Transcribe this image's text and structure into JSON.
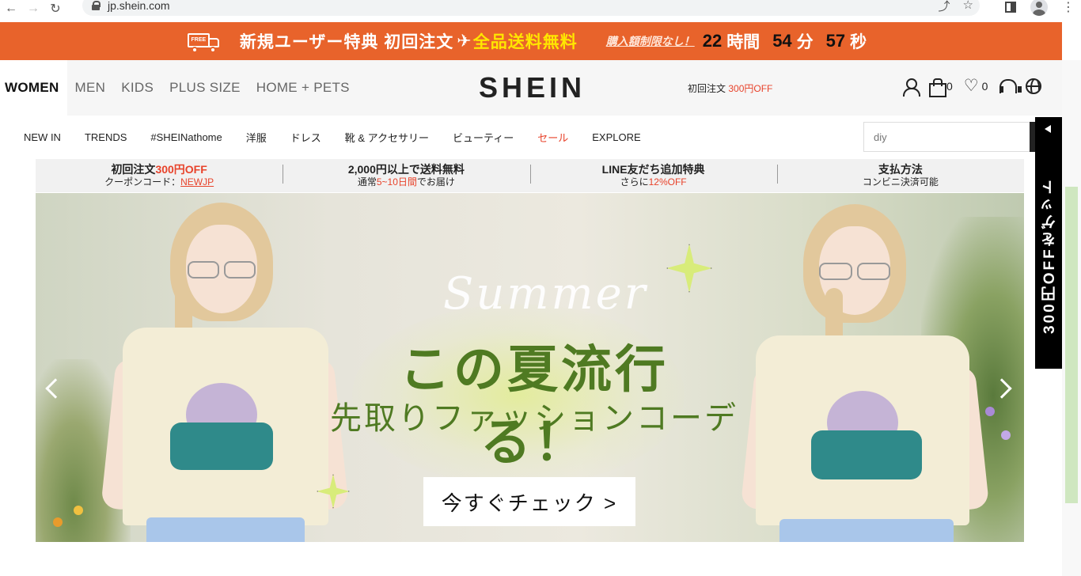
{
  "browser": {
    "url": "jp.shein.com"
  },
  "promo": {
    "truck_label": "FREE",
    "text_main": "新規ユーザー特典 初回注文",
    "text_yellow": "全品送料無料",
    "limit_text": "購入額制限なし！",
    "hours": "22",
    "hours_unit": "時間",
    "minutes": "54",
    "minutes_unit": "分",
    "seconds": "57",
    "seconds_unit": "秒"
  },
  "header": {
    "categories": [
      "WOMEN",
      "MEN",
      "KIDS",
      "PLUS SIZE",
      "HOME + PETS"
    ],
    "logo": "SHEIN",
    "first_order_label": "初回注文",
    "first_order_value": "300円OFF",
    "cart_count": "0",
    "wishlist_count": "0"
  },
  "subnav": {
    "items": [
      "NEW IN",
      "TRENDS",
      "#SHEINathome",
      "洋服",
      "ドレス",
      "靴 & アクセサリー",
      "ビューティー",
      "セール",
      "EXPLORE"
    ],
    "search_placeholder": "diy"
  },
  "side_tab": {
    "text": "300円OFFをゲット"
  },
  "benefits": [
    {
      "line1_a": "初回注文",
      "line1_b": "300円OFF",
      "line2_a": "クーポンコード：",
      "line2_b": "NEWJP"
    },
    {
      "line1_a": "2,000円以上で送料無料",
      "line2_a": "通常",
      "line2_b": "5~10日間",
      "line2_c": "でお届け"
    },
    {
      "line1_a": "LINE友だち追加特典",
      "line2_a": "さらに",
      "line2_b": "12%OFF"
    },
    {
      "line1_a": "支払方法",
      "line2_a": "コンビニ決済可能"
    }
  ],
  "hero": {
    "script_text": "Summer",
    "headline": "この夏流行る！",
    "subheadline": "先取りファッションコーデ",
    "cta": "今すぐチェック >"
  },
  "colors": {
    "promo_bg": "#e8632b",
    "accent_red": "#e8432b",
    "hero_green": "#4f7a22"
  }
}
